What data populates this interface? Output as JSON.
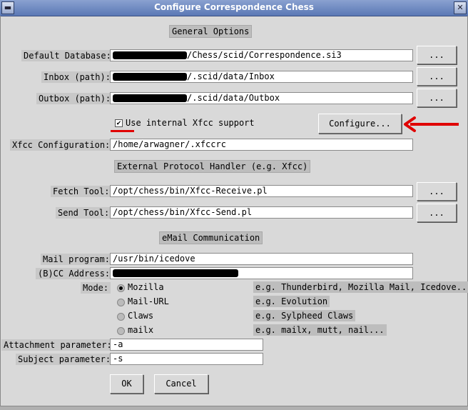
{
  "window": {
    "title": "Configure Correspondence Chess"
  },
  "general": {
    "header": "General Options",
    "default_db_label": "Default Database:",
    "default_db_value": "/Chess/scid/Correspondence.si3",
    "inbox_label": "Inbox (path):",
    "inbox_value": "/.scid/data/Inbox",
    "outbox_label": "Outbox (path):",
    "outbox_value": "/.scid/data/Outbox",
    "browse_label": "...",
    "xfcc_check_label": "Use internal Xfcc support",
    "configure_label": "Configure...",
    "xfcc_config_label": "Xfcc Configuration:",
    "xfcc_config_value": "/home/arwagner/.xfccrc"
  },
  "external": {
    "header": "External Protocol Handler (e.g. Xfcc)",
    "fetch_label": "Fetch Tool:",
    "fetch_value": "/opt/chess/bin/Xfcc-Receive.pl",
    "send_label": "Send Tool:",
    "send_value": "/opt/chess/bin/Xfcc-Send.pl"
  },
  "email": {
    "header": "eMail Communication",
    "program_label": "Mail program:",
    "program_value": "/usr/bin/icedove",
    "cc_label": "(B)CC Address:",
    "mode_label": "Mode:",
    "modes": [
      {
        "label": "Mozilla",
        "hint": "e.g. Thunderbird, Mozilla Mail, Icedove..."
      },
      {
        "label": "Mail-URL",
        "hint": "e.g. Evolution"
      },
      {
        "label": "Claws",
        "hint": "e.g. Sylpheed Claws"
      },
      {
        "label": "mailx",
        "hint": "e.g. mailx, mutt, nail..."
      }
    ],
    "attach_label": "Attachment parameter:",
    "attach_value": "-a",
    "subject_label": "Subject parameter:",
    "subject_value": "-s"
  },
  "buttons": {
    "ok": "OK",
    "cancel": "Cancel"
  },
  "icons": {
    "menu": "window-menu-icon",
    "close": "close-icon"
  },
  "colors": {
    "annotation": "#e00000",
    "titlebar": "#6f8bc4"
  }
}
